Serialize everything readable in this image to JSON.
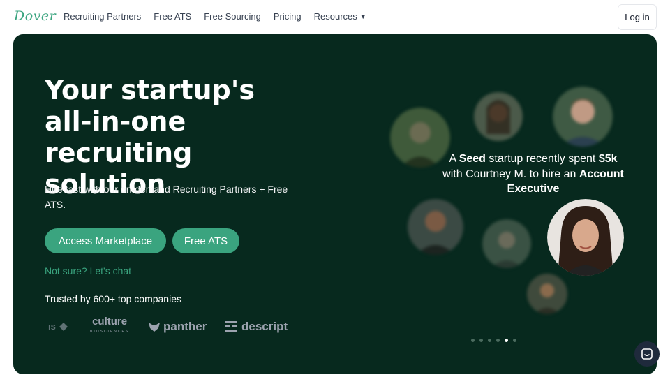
{
  "nav": {
    "logo": "Dover",
    "links": [
      "Recruiting Partners",
      "Free ATS",
      "Free Sourcing",
      "Pricing",
      "Resources"
    ],
    "login": "Log in"
  },
  "hero": {
    "title_lines": [
      "Your startup's",
      "all-in-one recruiting",
      "solution"
    ],
    "subtitle": "Hire fast with our on-demand Recruiting Partners + Free ATS.",
    "cta_primary": "Access Marketplace",
    "cta_secondary": "Free ATS",
    "chat_link": "Not sure? Let's chat",
    "trusted": "Trusted by 600+ top companies",
    "company_logos": {
      "l1": "ıs",
      "culture_top": "culture",
      "culture_bottom": "BIOSCIENCES",
      "panther": "panther",
      "descript": "descript"
    }
  },
  "testimonial": {
    "p1": "A ",
    "b1": "Seed",
    "p2": " startup recently spent ",
    "b2": "$5k",
    "p3": " with Courtney M. to hire an ",
    "b3": "Account Executive"
  },
  "carousel": {
    "count": 6,
    "active_index": 4
  },
  "colors": {
    "brand": "#3aa47f",
    "hero_bg": "#07291e"
  }
}
